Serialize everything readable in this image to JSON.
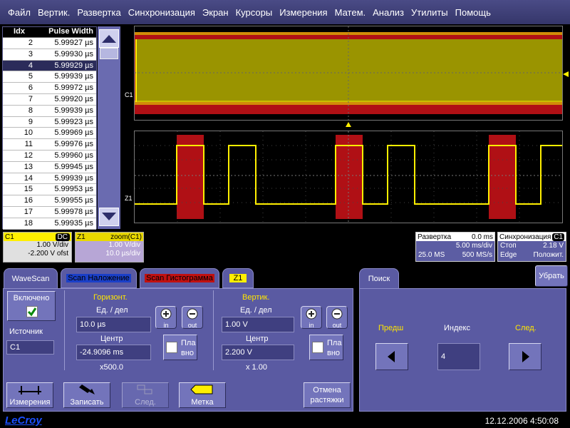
{
  "menu": [
    "Файл",
    "Вертик.",
    "Развертка",
    "Синхронизация",
    "Экран",
    "Курсоры",
    "Измерения",
    "Матем.",
    "Анализ",
    "Утилиты",
    "Помощь"
  ],
  "table": {
    "headers": [
      "Idx",
      "Pulse Width"
    ],
    "rows": [
      [
        "2",
        "5.99927 µs"
      ],
      [
        "3",
        "5.99930 µs"
      ],
      [
        "4",
        "5.99929 µs"
      ],
      [
        "5",
        "5.99939 µs"
      ],
      [
        "6",
        "5.99972 µs"
      ],
      [
        "7",
        "5.99920 µs"
      ],
      [
        "8",
        "5.99939 µs"
      ],
      [
        "9",
        "5.99923 µs"
      ],
      [
        "10",
        "5.99969 µs"
      ],
      [
        "11",
        "5.99976 µs"
      ],
      [
        "12",
        "5.99960 µs"
      ],
      [
        "13",
        "5.99945 µs"
      ],
      [
        "14",
        "5.99939 µs"
      ],
      [
        "15",
        "5.99953 µs"
      ],
      [
        "16",
        "5.99955 µs"
      ],
      [
        "17",
        "5.99978 µs"
      ],
      [
        "18",
        "5.99935 µs"
      ]
    ],
    "selected_index": "4"
  },
  "waveform": {
    "top_label": "C1",
    "bottom_label": "Z1"
  },
  "c1": {
    "name": "C1",
    "coupling": "DC",
    "vdiv": "1.00 V/div",
    "offset": "-2.200 V ofst"
  },
  "z1": {
    "name": "Z1",
    "title": "zoom(C1)",
    "vdiv": "1.00 V/div",
    "tdiv": "10.0 µs/div"
  },
  "timebase": {
    "title": "Развертка",
    "delay": "0.0 ms",
    "tdiv": "5.00 ms/div",
    "samples": "25.0 MS",
    "rate": "500 MS/s"
  },
  "trigger": {
    "title": "Синхронизация",
    "src": "C1",
    "state": "Стоп",
    "level": "2.18 V",
    "type": "Edge",
    "slope": "Положит."
  },
  "tabs": {
    "wavescan": "WaveScan",
    "overlay": "Scan Наложение",
    "histogram": "Scan Гистограмма",
    "z1": "Z1",
    "search": "Поиск",
    "close": "Убрать"
  },
  "panel": {
    "enabled_label": "Включено",
    "source_label": "Источник",
    "source_value": "C1",
    "horiz_title": "Горизонт.",
    "horiz_unit_label": "Ед. / дел",
    "horiz_unit_value": "10.0 µs",
    "horiz_center_label": "Центр",
    "horiz_center_value": "-24.9096 ms",
    "horiz_factor": "x500.0",
    "vert_title": "Вертик.",
    "vert_unit_label": "Ед. / дел",
    "vert_unit_value": "1.00 V",
    "vert_center_label": "Центр",
    "vert_center_value": "2.200 V",
    "vert_factor": "x 1.00",
    "smooth_label": "Пла вно",
    "zoom_in": "in",
    "zoom_out": "out",
    "btn_measure": "Измерения",
    "btn_record": "Записать",
    "btn_next": "След.",
    "btn_mark": "Метка",
    "btn_cancel": "Отмена растяжки"
  },
  "search": {
    "prev": "Предш",
    "index_label": "Индекс",
    "next": "След.",
    "index_value": "4"
  },
  "footer": {
    "brand": "LeCroy",
    "datetime": "12.12.2006 4:50:08"
  },
  "colors": {
    "trace": "#ffef00",
    "highlight": "#b01015",
    "panel": "#5a5aa2",
    "menubar": "#3d3e78"
  }
}
